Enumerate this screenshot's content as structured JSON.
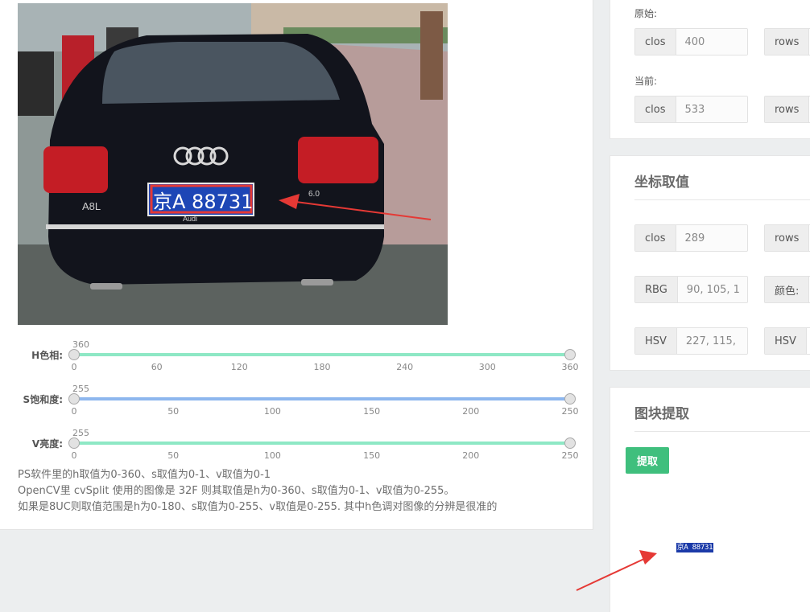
{
  "photo": {
    "plate_text": "京A 88731",
    "badge_text": "A8L",
    "plate_frame_text": "Audi",
    "trunk_badge": "6.0"
  },
  "sliders": [
    {
      "label": "H色相:",
      "value": "360",
      "ticks": [
        "0",
        "60",
        "120",
        "180",
        "240",
        "300",
        "360"
      ],
      "color": "#8ee8c5",
      "level": 1.0
    },
    {
      "label": "S饱和度:",
      "value": "255",
      "ticks": [
        "0",
        "50",
        "100",
        "150",
        "200",
        "250"
      ],
      "color": "#8eb7ee",
      "level": 1.0
    },
    {
      "label": "V亮度:",
      "value": "255",
      "ticks": [
        "0",
        "50",
        "100",
        "150",
        "200",
        "250"
      ],
      "color": "#8ee8c5",
      "level": 1.0
    }
  ],
  "notes": [
    "PS软件里的h取值为0-360、s取值为0-1、v取值为0-1",
    "OpenCV里 cvSplit 使用的图像是 32F 则其取值是h为0-360、s取值为0-1、v取值为0-255。",
    "如果是8UC则取值范围是h为0-180、s取值为0-255、v取值是0-255. 其中h色调对图像的分辨是很准的"
  ],
  "size_card": {
    "original_label": "原始:",
    "original_cols_label": "clos",
    "original_cols_value": "400",
    "original_rows_label": "rows",
    "current_label": "当前:",
    "current_cols_label": "clos",
    "current_cols_value": "533",
    "current_rows_label": "rows"
  },
  "coord_card": {
    "title": "坐标取值",
    "cols_label": "clos",
    "cols_value": "289",
    "rows_label": "rows",
    "rbg_label": "RBG",
    "rbg_value": "90, 105, 1",
    "color_label": "颜色:",
    "hsv_label": "HSV",
    "hsv_value": "227, 115,",
    "hsv2_label": "HSV"
  },
  "extract_card": {
    "title": "图块提取",
    "button_label": "提取",
    "result_text": "京A 88731"
  },
  "colors": {
    "button_green": "#3fbf7d",
    "arrow_red": "#e53935",
    "plate_blue": "#1b3aa8"
  }
}
